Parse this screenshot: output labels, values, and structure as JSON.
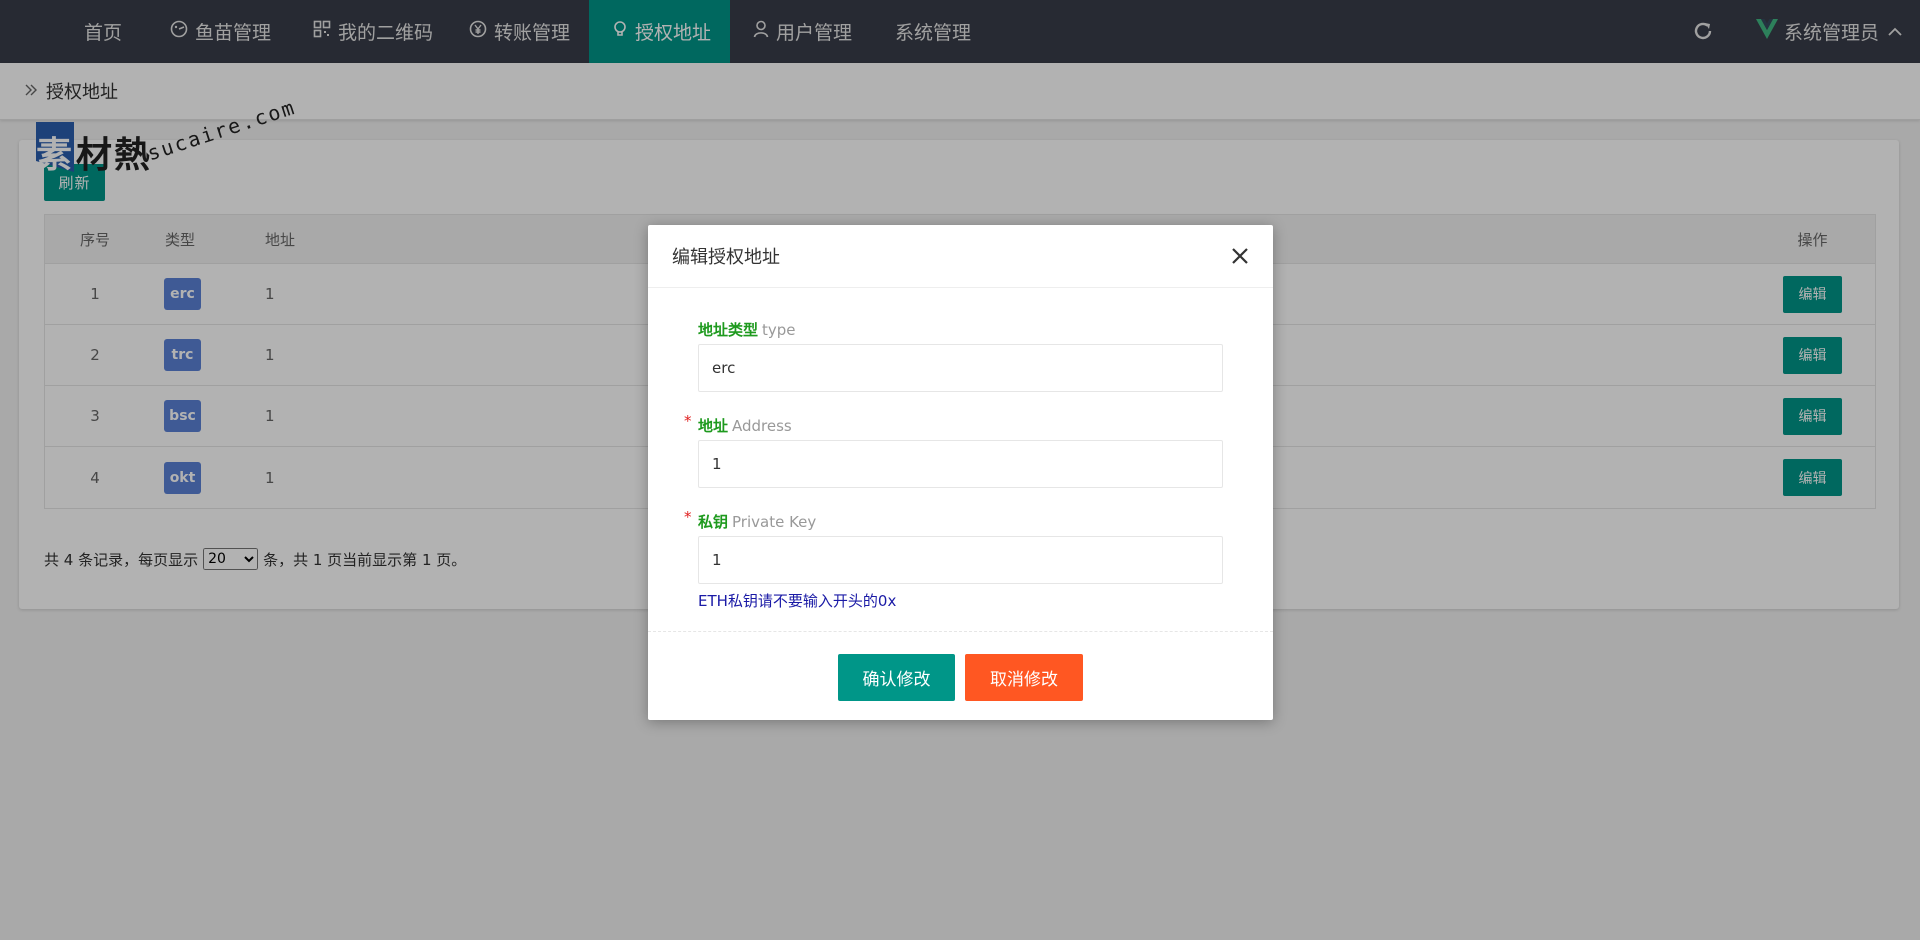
{
  "nav": {
    "items": [
      {
        "label": "首页",
        "icon": ""
      },
      {
        "label": "鱼苗管理",
        "icon": "fish-icon"
      },
      {
        "label": "我的二维码",
        "icon": "qrcode-icon"
      },
      {
        "label": "转账管理",
        "icon": "yen-icon"
      },
      {
        "label": "授权地址",
        "icon": "lightbulb-icon",
        "active": true
      },
      {
        "label": "用户管理",
        "icon": "user-icon"
      },
      {
        "label": "系统管理",
        "icon": ""
      }
    ],
    "refresh_icon": "refresh-icon",
    "admin_label": "系统管理员"
  },
  "breadcrumb": {
    "label": "授权地址"
  },
  "toolbar": {
    "refresh_label": "刷新"
  },
  "table": {
    "headers": {
      "index": "序号",
      "type": "类型",
      "address": "地址",
      "action": "操作"
    },
    "rows": [
      {
        "index": "1",
        "type": "erc",
        "address": "1",
        "action": "编辑"
      },
      {
        "index": "2",
        "type": "trc",
        "address": "1",
        "action": "编辑"
      },
      {
        "index": "3",
        "type": "bsc",
        "address": "1",
        "action": "编辑"
      },
      {
        "index": "4",
        "type": "okt",
        "address": "1",
        "action": "编辑"
      }
    ]
  },
  "pager": {
    "prefix": "共 4 条记录，每页显示",
    "page_size": "20",
    "suffix": "条，共 1 页当前显示第 1 页。"
  },
  "watermark": {
    "chars": "素材熱",
    "url": "sucaire.com"
  },
  "modal": {
    "title": "编辑授权地址",
    "close_icon": "close-icon",
    "type_label_cn": "地址类型",
    "type_label_en": "type",
    "type_value": "erc",
    "address_label_cn": "地址",
    "address_label_en": "Address",
    "address_value": "1",
    "key_label_cn": "私钥",
    "key_label_en": "Private Key",
    "key_value": "1",
    "required_mark": "*",
    "hint": "ETH私钥请不要输入开头的0x",
    "confirm_label": "确认修改",
    "cancel_label": "取消修改"
  }
}
